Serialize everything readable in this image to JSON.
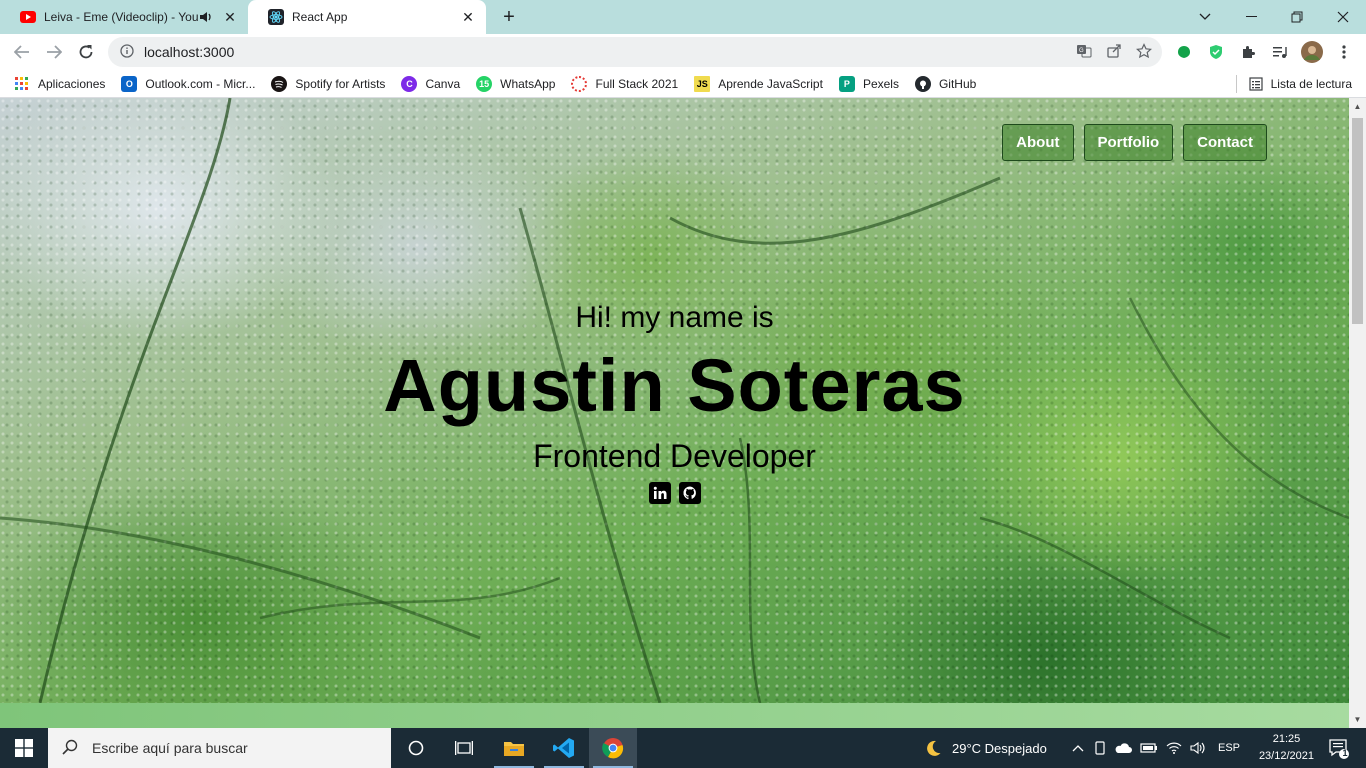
{
  "browser": {
    "tabs": [
      {
        "title": "Leiva - Eme (Videoclip) - YouTube",
        "active": false
      },
      {
        "title": "React App",
        "active": true
      }
    ],
    "address": "localhost:3000",
    "bookmarks": [
      {
        "label": "Aplicaciones",
        "icon": "apps-grid-icon",
        "color": "#ea4335"
      },
      {
        "label": "Outlook.com - Micr...",
        "icon": "outlook-icon",
        "color": "#0a64c8"
      },
      {
        "label": "Spotify for Artists",
        "icon": "spotify-icon",
        "color": "#191414"
      },
      {
        "label": "Canva",
        "icon": "canva-icon",
        "color": "#7d2ae8"
      },
      {
        "label": "WhatsApp",
        "icon": "whatsapp-icon",
        "color": "#25d366"
      },
      {
        "label": "Full Stack 2021",
        "icon": "fullstack-icon",
        "color": "#e53935"
      },
      {
        "label": "Aprende JavaScript",
        "icon": "javascript-icon",
        "color": "#f0db4f"
      },
      {
        "label": "Pexels",
        "icon": "pexels-icon",
        "color": "#05a081"
      },
      {
        "label": "GitHub",
        "icon": "github-icon",
        "color": "#24292e"
      }
    ],
    "reading_list": "Lista de lectura"
  },
  "page": {
    "nav": [
      "About",
      "Portfolio",
      "Contact"
    ],
    "greeting": "Hi! my name is",
    "name": "Agustin Soteras",
    "role": "Frontend Developer",
    "socials": [
      "linkedin-icon",
      "github-icon"
    ]
  },
  "taskbar": {
    "search_placeholder": "Escribe aquí para buscar",
    "weather": "29°C  Despejado",
    "language": "ESP",
    "time": "21:25",
    "date": "23/12/2021",
    "notifications": "1"
  },
  "colors": {
    "tabstrip": "#b9dedd",
    "taskbar": "#1b2b36",
    "accent_green": "#3c8228"
  }
}
